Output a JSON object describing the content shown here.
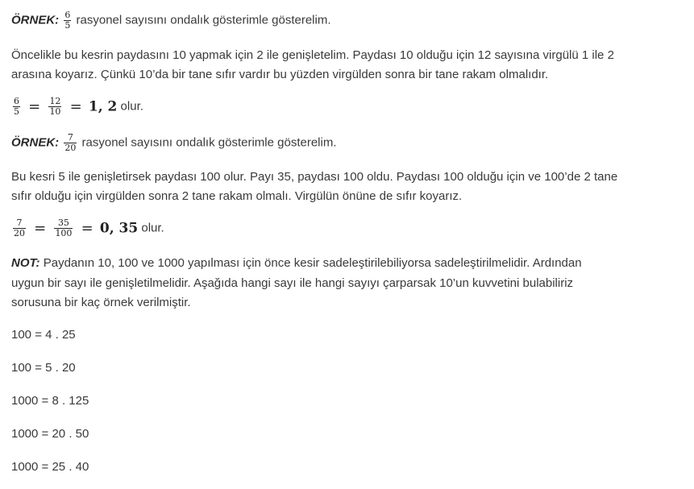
{
  "example1": {
    "label": "ÖRNEK:",
    "frac_num": "6",
    "frac_den": "5",
    "text": "rasyonel sayısını ondalık gösterimle gösterelim."
  },
  "para1": {
    "line1": "Öncelikle bu kesrin paydasını 10 yapmak için 2 ile genişletelim. Paydası 10 olduğu için 12 sayısına virgülü 1 ile 2",
    "line2": "arasına koyarız. Çünkü 10’da bir tane sıfır vardır bu yüzden virgülden sonra bir tane rakam olmalıdır."
  },
  "eq1": {
    "f1_num": "6",
    "f1_den": "5",
    "eq_sign": "=",
    "f2_num": "12",
    "f2_den": "10",
    "eq_sign2": "=",
    "result": "1, 2",
    "suffix": "olur."
  },
  "example2": {
    "label": "ÖRNEK:",
    "frac_num": "7",
    "frac_den": "20",
    "text": "rasyonel sayısını ondalık gösterimle gösterelim."
  },
  "para2": {
    "line1": "Bu kesri 5 ile genişletirsek paydası 100 olur. Payı 35, paydası 100 oldu. Paydası 100 olduğu için ve 100’de 2 tane",
    "line2": "sıfır olduğu için virgülden sonra 2 tane rakam olmalı. Virgülün önüne de sıfır koyarız."
  },
  "eq2": {
    "f1_num": "7",
    "f1_den": "20",
    "eq_sign": "=",
    "f2_num": "35",
    "f2_den": "100",
    "eq_sign2": "=",
    "result": "0, 35",
    "suffix": "olur."
  },
  "note": {
    "label": "NOT:",
    "line1": "Paydanın 10, 100 ve 1000 yapılması için önce kesir sadeleştirilebiliyorsa sadeleştirilmelidir. Ardından",
    "line2": "uygun bir sayı ile genişletilmelidir. Aşağıda hangi sayı ile hangi sayıyı çarparsak 10’un kuvvetini bulabiliriz",
    "line3": "sorusuna bir kaç örnek verilmiştir."
  },
  "products": [
    "100 = 4 . 25",
    "100 = 5 . 20",
    "1000 = 8 . 125",
    "1000 = 20 . 50",
    "1000 = 25 . 40"
  ]
}
